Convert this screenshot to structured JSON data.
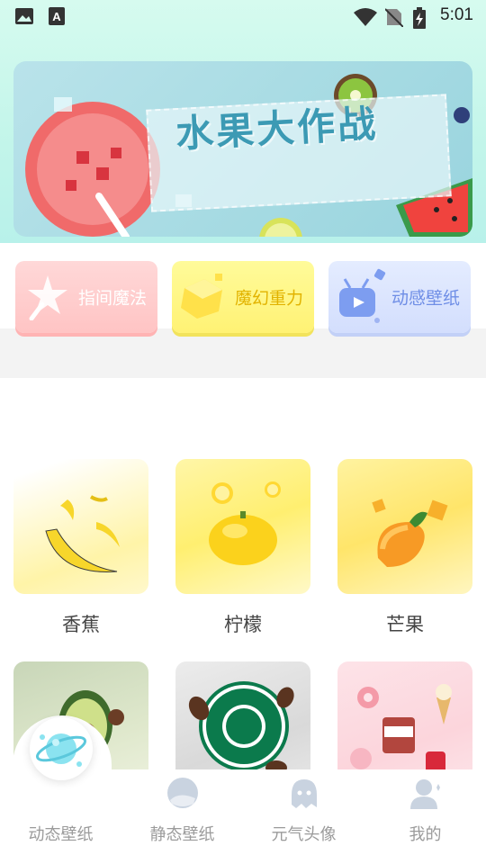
{
  "status_bar": {
    "time": "5:01",
    "icons": [
      "image-icon",
      "a-icon",
      "wifi-icon",
      "no-sim-icon",
      "battery-charging-icon"
    ]
  },
  "banner": {
    "title": "水果大作战"
  },
  "features": [
    {
      "label": "指间魔法",
      "icon": "magic-wand-icon",
      "color": "#ffc4c4"
    },
    {
      "label": "魔幻重力",
      "icon": "gravity-cube-icon",
      "color": "#fff274"
    },
    {
      "label": "动感壁纸",
      "icon": "tv-play-icon",
      "color": "#d3defd"
    }
  ],
  "grid": [
    {
      "label": "香蕉",
      "image": "banana"
    },
    {
      "label": "柠檬",
      "image": "lemon"
    },
    {
      "label": "芒果",
      "image": "mango"
    },
    {
      "label": "",
      "image": "avocado"
    },
    {
      "label": "",
      "image": "starbucks-coffee"
    },
    {
      "label": "",
      "image": "sweets-drinks"
    }
  ],
  "tabs": [
    {
      "label": "动态壁纸",
      "icon": "planet-icon",
      "active": true
    },
    {
      "label": "静态壁纸",
      "icon": "landscape-icon",
      "active": false
    },
    {
      "label": "元气头像",
      "icon": "ghost-icon",
      "active": false
    },
    {
      "label": "我的",
      "icon": "user-icon",
      "active": false
    }
  ],
  "colors": {
    "accent": "#8be3f0",
    "tab_inactive": "#9b9b9b",
    "top_bg": "#c2f5ea"
  }
}
